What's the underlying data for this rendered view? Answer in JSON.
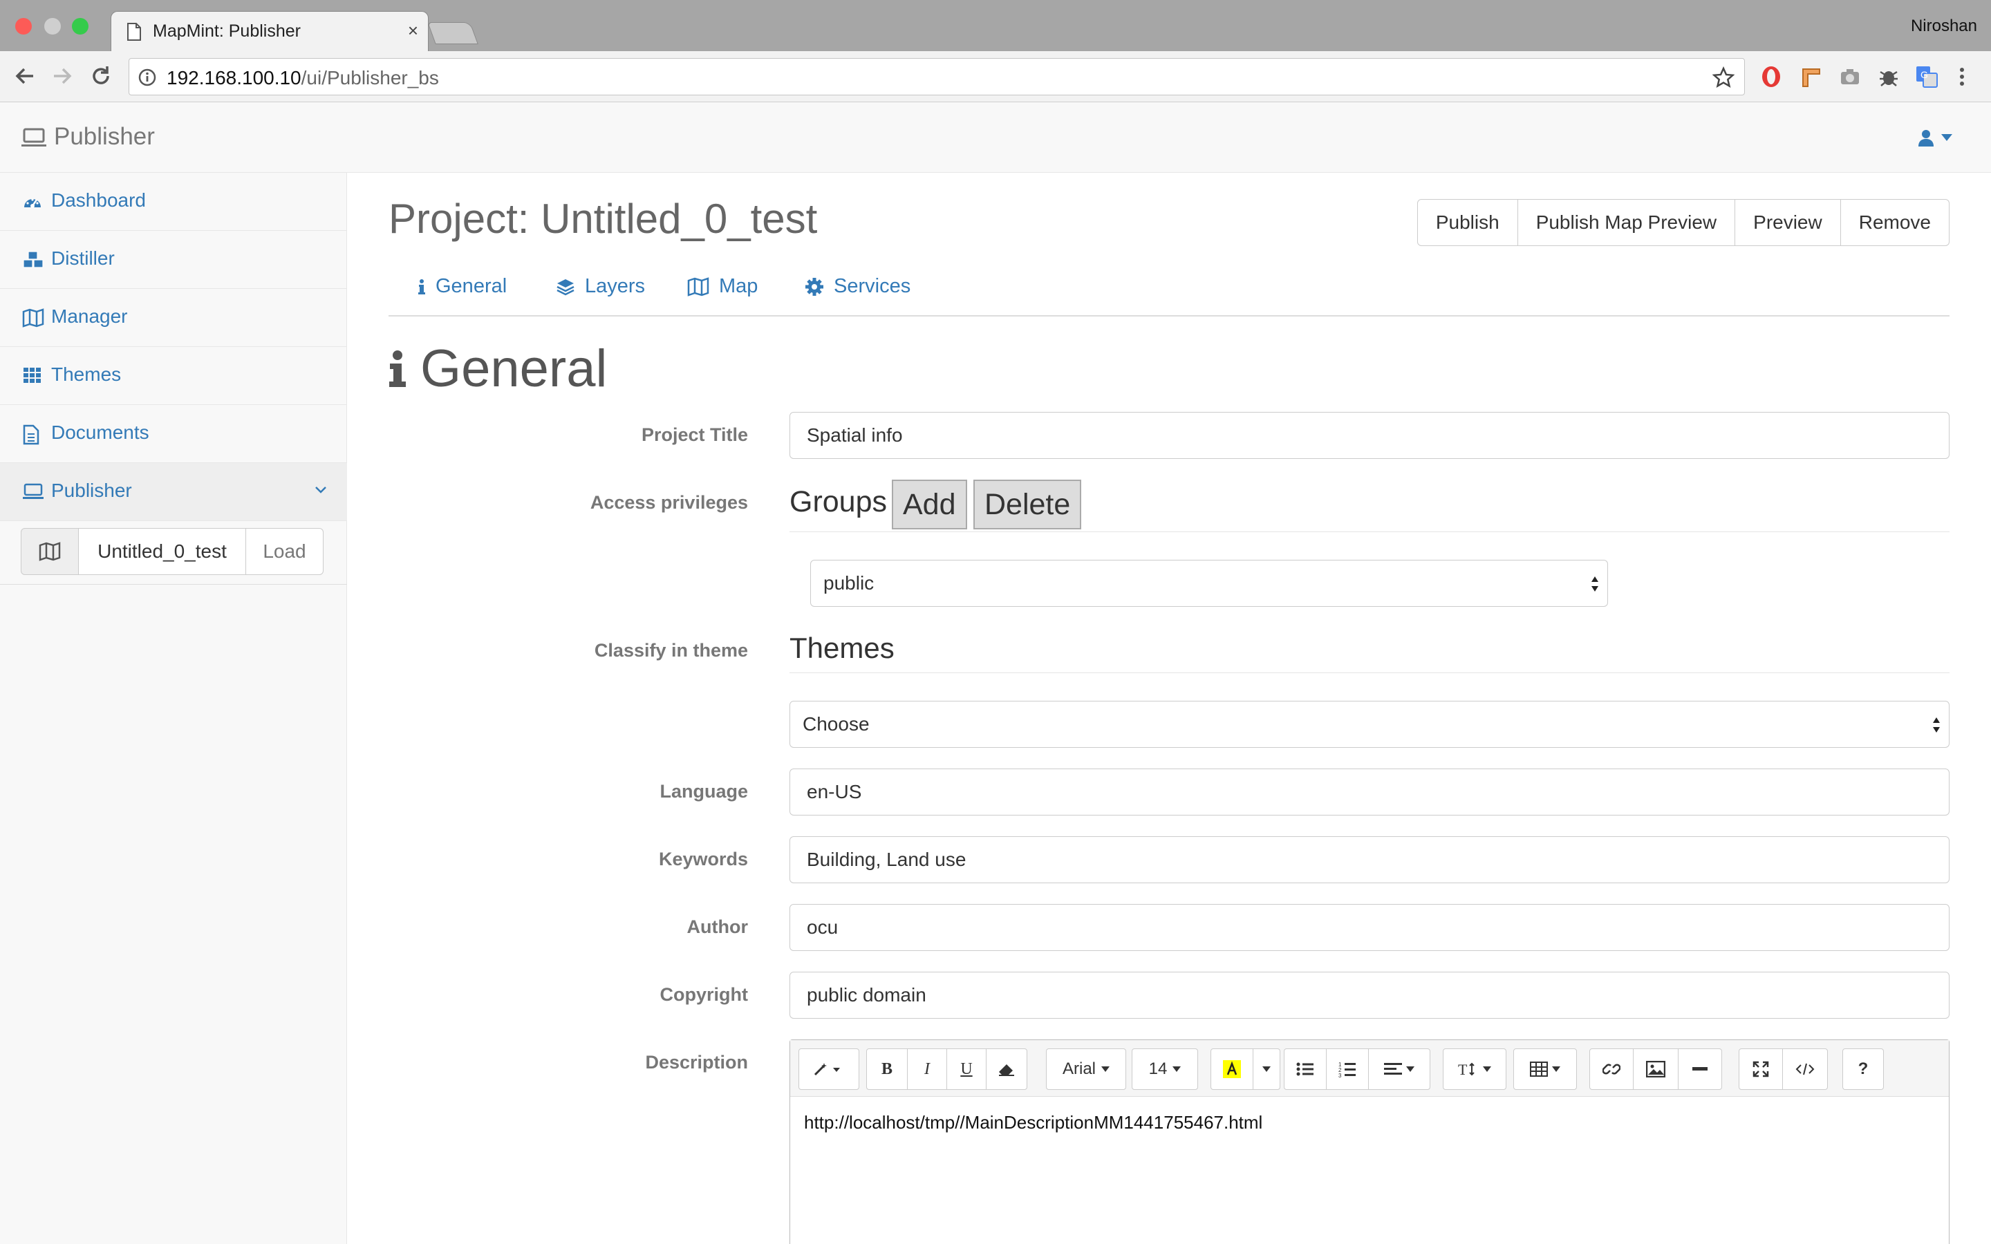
{
  "browser": {
    "tab_title": "MapMint: Publisher",
    "tab_close": "×",
    "profile_name": "Niroshan",
    "url_host": "192.168.100.10",
    "url_path": "/ui/Publisher_bs"
  },
  "app": {
    "brand": "Publisher"
  },
  "sidebar": {
    "items": [
      {
        "label": "Dashboard",
        "icon": "dashboard-icon"
      },
      {
        "label": "Distiller",
        "icon": "cubes-icon"
      },
      {
        "label": "Manager",
        "icon": "map-icon"
      },
      {
        "label": "Themes",
        "icon": "grid-icon"
      },
      {
        "label": "Documents",
        "icon": "document-icon"
      },
      {
        "label": "Publisher",
        "icon": "laptop-icon"
      }
    ],
    "project": {
      "name": "Untitled_0_test",
      "load": "Load"
    }
  },
  "main": {
    "title": "Project: Untitled_0_test",
    "actions": [
      "Publish",
      "Publish Map Preview",
      "Preview",
      "Remove"
    ],
    "tabs": [
      "General",
      "Layers",
      "Map",
      "Services"
    ],
    "section_title": "General"
  },
  "form": {
    "project_title_label": "Project Title",
    "project_title_value": "Spatial info",
    "access_label": "Access privileges",
    "groups_label": "Groups",
    "add_label": "Add",
    "delete_label": "Delete",
    "group_value": "public",
    "classify_label": "Classify in theme",
    "themes_label": "Themes",
    "theme_value": "Choose",
    "language_label": "Language",
    "language_value": "en-US",
    "keywords_label": "Keywords",
    "keywords_value": "Building, Land use",
    "author_label": "Author",
    "author_value": "ocu",
    "copyright_label": "Copyright",
    "copyright_value": "public domain",
    "description_label": "Description"
  },
  "editor": {
    "font_name": "Arial",
    "font_size": "14",
    "content": "http://localhost/tmp//MainDescriptionMM1441755467.html",
    "help": "?"
  },
  "colors": {
    "link": "#337ab7",
    "chrome": "#a6a6a6"
  }
}
